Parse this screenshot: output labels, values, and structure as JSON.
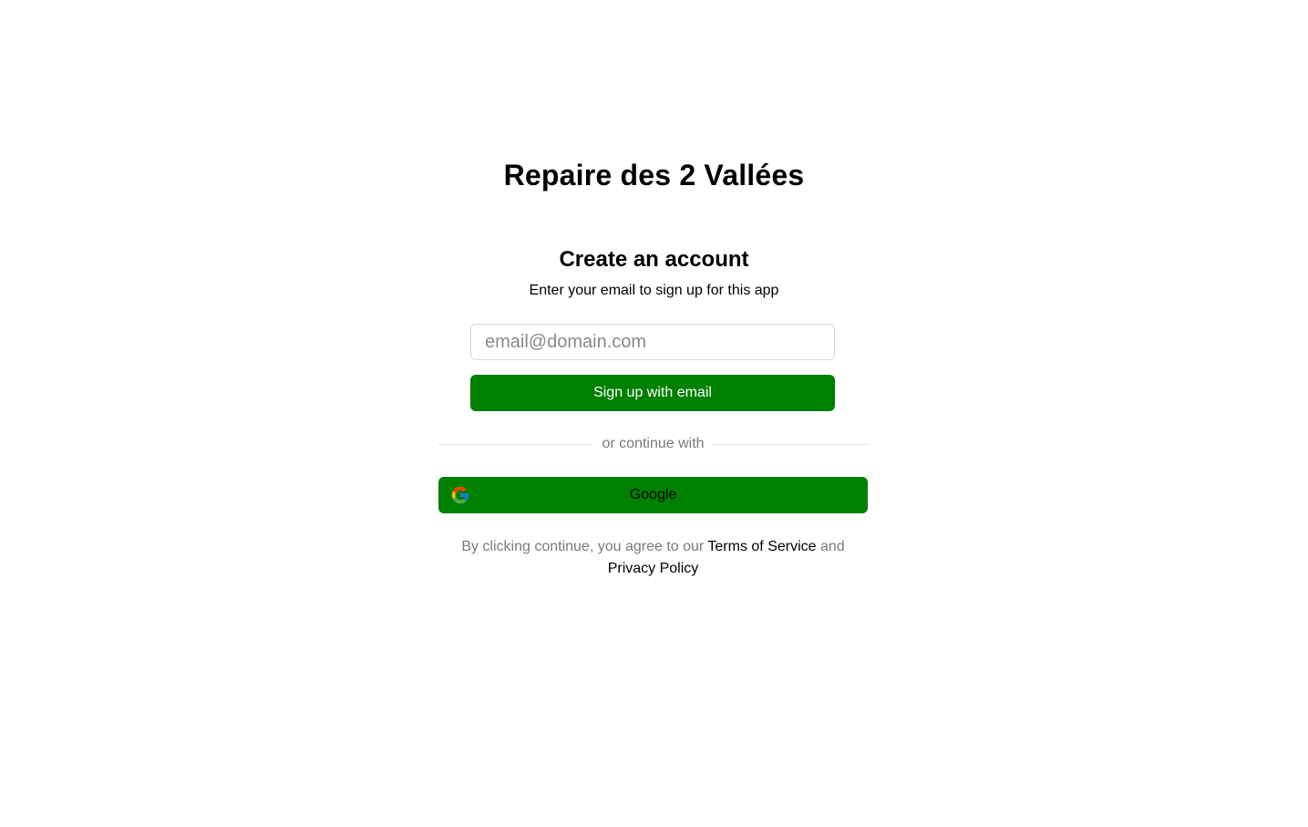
{
  "app": {
    "title": "Repaire des 2 Vallées"
  },
  "signup": {
    "heading": "Create an account",
    "subheading": "Enter your email to sign up for this app",
    "email_placeholder": "email@domain.com",
    "email_value": "",
    "submit_label": "Sign up with email"
  },
  "divider": {
    "text": "or continue with"
  },
  "oauth": {
    "google_label": "Google",
    "google_icon": "google-icon"
  },
  "legal": {
    "prefix": "By clicking continue, you agree to our ",
    "terms_label": "Terms of Service",
    "middle": " and ",
    "privacy_label": "Privacy Policy"
  },
  "colors": {
    "accent": "#008000",
    "background": "#ffffff",
    "muted_text": "#7a7a7a",
    "input_border": "#d6d6d6"
  }
}
